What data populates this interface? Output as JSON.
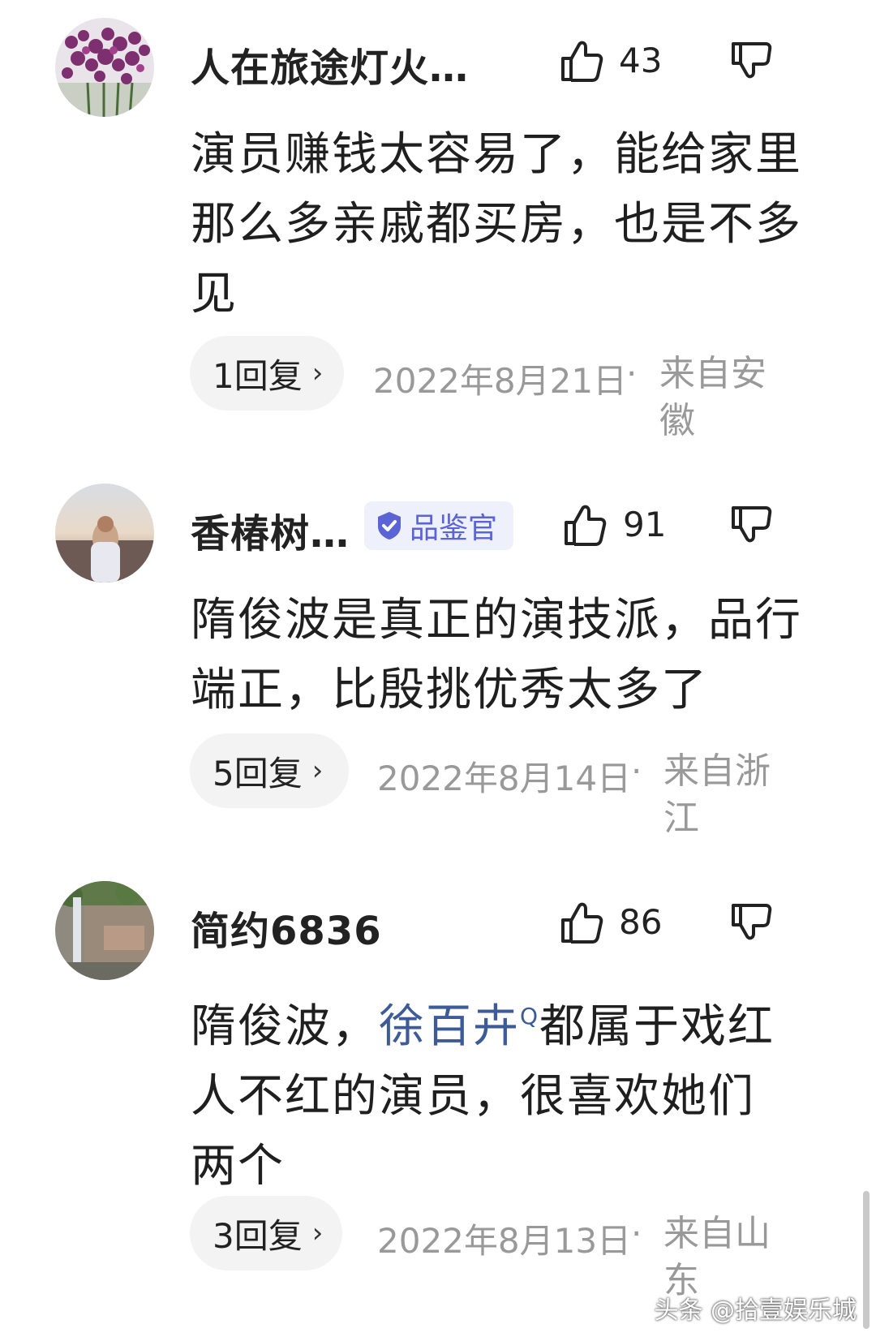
{
  "comments": [
    {
      "username": "人在旅途灯火…",
      "badge": null,
      "likes": "43",
      "text": "演员赚钱太容易了，能给家里那么多亲戚都买房，也是不多见",
      "replies": "1回复",
      "date": "2022年8月21日",
      "location": "来自安徽"
    },
    {
      "username": "香椿树…",
      "badge": "品鉴官",
      "likes": "91",
      "text": "隋俊波是真正的演技派，品行端正，比殷挑优秀太多了",
      "replies": "5回复",
      "date": "2022年8月14日",
      "location": "来自浙江"
    },
    {
      "username": "简约6836",
      "badge": null,
      "likes": "86",
      "text_before": "隋俊波，",
      "text_link": "徐百卉",
      "text_link_sup": "Q",
      "text_after": "都属于戏红人不红的演员，很喜欢她们两个",
      "replies": "3回复",
      "date": "2022年8月13日",
      "location": "来自山东"
    }
  ],
  "separator": "·",
  "reply_chevron": "›",
  "watermark": "头条 @拾壹娱乐城",
  "icons": {
    "like": "thumbs-up-icon",
    "dislike": "thumbs-down-icon",
    "badge": "verified-shield-icon"
  },
  "colors": {
    "badge_bg": "#eef0fb",
    "badge_text": "#5a64d6",
    "link": "#3d5a99",
    "meta_gray": "#999999"
  }
}
